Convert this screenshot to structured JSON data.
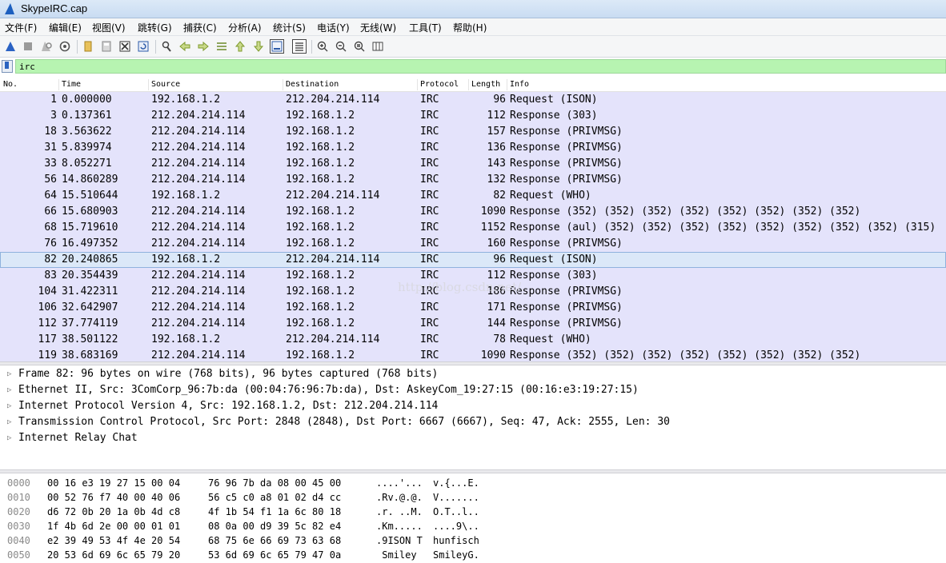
{
  "window": {
    "title": "SkypeIRC.cap"
  },
  "menu": [
    "文件(F)",
    "编辑(E)",
    "视图(V)",
    "跳转(G)",
    "捕获(C)",
    "分析(A)",
    "统计(S)",
    "电话(Y)",
    "无线(W)",
    "工具(T)",
    "帮助(H)"
  ],
  "toolbar": {
    "icons": [
      "start-capture-icon",
      "stop-capture-icon",
      "restart-capture-icon",
      "capture-options-icon",
      "open-file-icon",
      "save-file-icon",
      "close-file-icon",
      "reload-file-icon",
      "find-packet-icon",
      "go-back-icon",
      "go-forward-icon",
      "go-to-packet-icon",
      "first-packet-icon",
      "last-packet-icon",
      "autoscroll-icon",
      "colorize-icon",
      "zoom-in-icon",
      "zoom-out-icon",
      "normal-size-icon",
      "resize-columns-icon"
    ]
  },
  "filter": {
    "value": "irc"
  },
  "columns": [
    "No.",
    "Time",
    "Source",
    "Destination",
    "Protocol",
    "Length",
    "Info"
  ],
  "packets": [
    {
      "no": "1",
      "time": "0.000000",
      "src": "192.168.1.2",
      "dst": "212.204.214.114",
      "proto": "IRC",
      "len": "96",
      "info": "Request (ISON)"
    },
    {
      "no": "3",
      "time": "0.137361",
      "src": "212.204.214.114",
      "dst": "192.168.1.2",
      "proto": "IRC",
      "len": "112",
      "info": "Response (303)"
    },
    {
      "no": "18",
      "time": "3.563622",
      "src": "212.204.214.114",
      "dst": "192.168.1.2",
      "proto": "IRC",
      "len": "157",
      "info": "Response (PRIVMSG)"
    },
    {
      "no": "31",
      "time": "5.839974",
      "src": "212.204.214.114",
      "dst": "192.168.1.2",
      "proto": "IRC",
      "len": "136",
      "info": "Response (PRIVMSG)"
    },
    {
      "no": "33",
      "time": "8.052271",
      "src": "212.204.214.114",
      "dst": "192.168.1.2",
      "proto": "IRC",
      "len": "143",
      "info": "Response (PRIVMSG)"
    },
    {
      "no": "56",
      "time": "14.860289",
      "src": "212.204.214.114",
      "dst": "192.168.1.2",
      "proto": "IRC",
      "len": "132",
      "info": "Response (PRIVMSG)"
    },
    {
      "no": "64",
      "time": "15.510644",
      "src": "192.168.1.2",
      "dst": "212.204.214.114",
      "proto": "IRC",
      "len": "82",
      "info": "Request (WHO)"
    },
    {
      "no": "66",
      "time": "15.680903",
      "src": "212.204.214.114",
      "dst": "192.168.1.2",
      "proto": "IRC",
      "len": "1090",
      "info": "Response (352) (352) (352) (352) (352) (352) (352) (352)"
    },
    {
      "no": "68",
      "time": "15.719610",
      "src": "212.204.214.114",
      "dst": "192.168.1.2",
      "proto": "IRC",
      "len": "1152",
      "info": "Response (aul) (352) (352) (352) (352) (352) (352) (352) (352) (315)"
    },
    {
      "no": "76",
      "time": "16.497352",
      "src": "212.204.214.114",
      "dst": "192.168.1.2",
      "proto": "IRC",
      "len": "160",
      "info": "Response (PRIVMSG)"
    },
    {
      "no": "82",
      "time": "20.240865",
      "src": "192.168.1.2",
      "dst": "212.204.214.114",
      "proto": "IRC",
      "len": "96",
      "info": "Request (ISON)",
      "selected": true
    },
    {
      "no": "83",
      "time": "20.354439",
      "src": "212.204.214.114",
      "dst": "192.168.1.2",
      "proto": "IRC",
      "len": "112",
      "info": "Response (303)"
    },
    {
      "no": "104",
      "time": "31.422311",
      "src": "212.204.214.114",
      "dst": "192.168.1.2",
      "proto": "IRC",
      "len": "186",
      "info": "Response (PRIVMSG)"
    },
    {
      "no": "106",
      "time": "32.642907",
      "src": "212.204.214.114",
      "dst": "192.168.1.2",
      "proto": "IRC",
      "len": "171",
      "info": "Response (PRIVMSG)"
    },
    {
      "no": "112",
      "time": "37.774119",
      "src": "212.204.214.114",
      "dst": "192.168.1.2",
      "proto": "IRC",
      "len": "144",
      "info": "Response (PRIVMSG)"
    },
    {
      "no": "117",
      "time": "38.501122",
      "src": "192.168.1.2",
      "dst": "212.204.214.114",
      "proto": "IRC",
      "len": "78",
      "info": "Request (WHO)"
    },
    {
      "no": "119",
      "time": "38.683169",
      "src": "212.204.214.114",
      "dst": "192.168.1.2",
      "proto": "IRC",
      "len": "1090",
      "info": "Response (352) (352) (352) (352) (352) (352) (352) (352)"
    }
  ],
  "watermark": "http://blog.csdn.net/",
  "details": [
    "Frame 82: 96 bytes on wire (768 bits), 96 bytes captured (768 bits)",
    "Ethernet II, Src: 3ComCorp_96:7b:da (00:04:76:96:7b:da), Dst: AskeyCom_19:27:15 (00:16:e3:19:27:15)",
    "Internet Protocol Version 4, Src: 192.168.1.2, Dst: 212.204.214.114",
    "Transmission Control Protocol, Src Port: 2848 (2848), Dst Port: 6667 (6667), Seq: 47, Ack: 2555, Len: 30",
    "Internet Relay Chat"
  ],
  "bytes": [
    {
      "offset": "0000",
      "hex1": "00 16 e3 19 27 15 00 04",
      "hex2": "76 96 7b da 08 00 45 00",
      "ascii1": "....'...",
      "ascii2": "v.{...E."
    },
    {
      "offset": "0010",
      "hex1": "00 52 76 f7 40 00 40 06",
      "hex2": "56 c5 c0 a8 01 02 d4 cc",
      "ascii1": ".Rv.@.@.",
      "ascii2": "V......."
    },
    {
      "offset": "0020",
      "hex1": "d6 72 0b 20 1a 0b 4d c8",
      "hex2": "4f 1b 54 f1 1a 6c 80 18",
      "ascii1": ".r. ..M.",
      "ascii2": "O.T..l.."
    },
    {
      "offset": "0030",
      "hex1": "1f 4b 6d 2e 00 00 01 01",
      "hex2": "08 0a 00 d9 39 5c 82 e4",
      "ascii1": ".Km.....",
      "ascii2": "....9\\.."
    },
    {
      "offset": "0040",
      "hex1": "e2 39 49 53 4f 4e 20 54",
      "hex2": "68 75 6e 66 69 73 63 68",
      "ascii1": ".9ISON T",
      "ascii2": "hunfisch"
    },
    {
      "offset": "0050",
      "hex1": "20 53 6d 69 6c 65 79 20",
      "hex2": "53 6d 69 6c 65 79 47 0a",
      "ascii1": " Smiley ",
      "ascii2": "SmileyG."
    }
  ]
}
